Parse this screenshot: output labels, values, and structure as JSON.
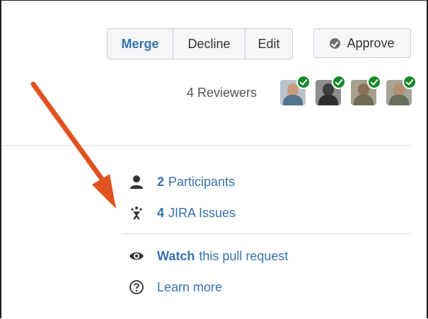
{
  "toolbar": {
    "merge_label": "Merge",
    "decline_label": "Decline",
    "edit_label": "Edit",
    "approve_label": "Approve"
  },
  "reviewers": {
    "label": "4 Reviewers",
    "avatars": [
      {
        "status": "approved"
      },
      {
        "status": "approved"
      },
      {
        "status": "approved"
      },
      {
        "status": "approved"
      }
    ]
  },
  "sidebar": {
    "participants_count": "2",
    "participants_label": "Participants",
    "jira_count": "4",
    "jira_label": "JIRA Issues",
    "watch_strong": "Watch",
    "watch_rest": "this pull request",
    "learn_more": "Learn more"
  },
  "colors": {
    "link": "#3572b0",
    "approved_badge": "#14892c",
    "annotation_arrow": "#e0521f"
  },
  "icons": {
    "approve": "check-circle-icon",
    "participants": "user-icon",
    "jira": "jira-icon",
    "watch": "eye-icon",
    "learn": "help-circle-icon"
  }
}
